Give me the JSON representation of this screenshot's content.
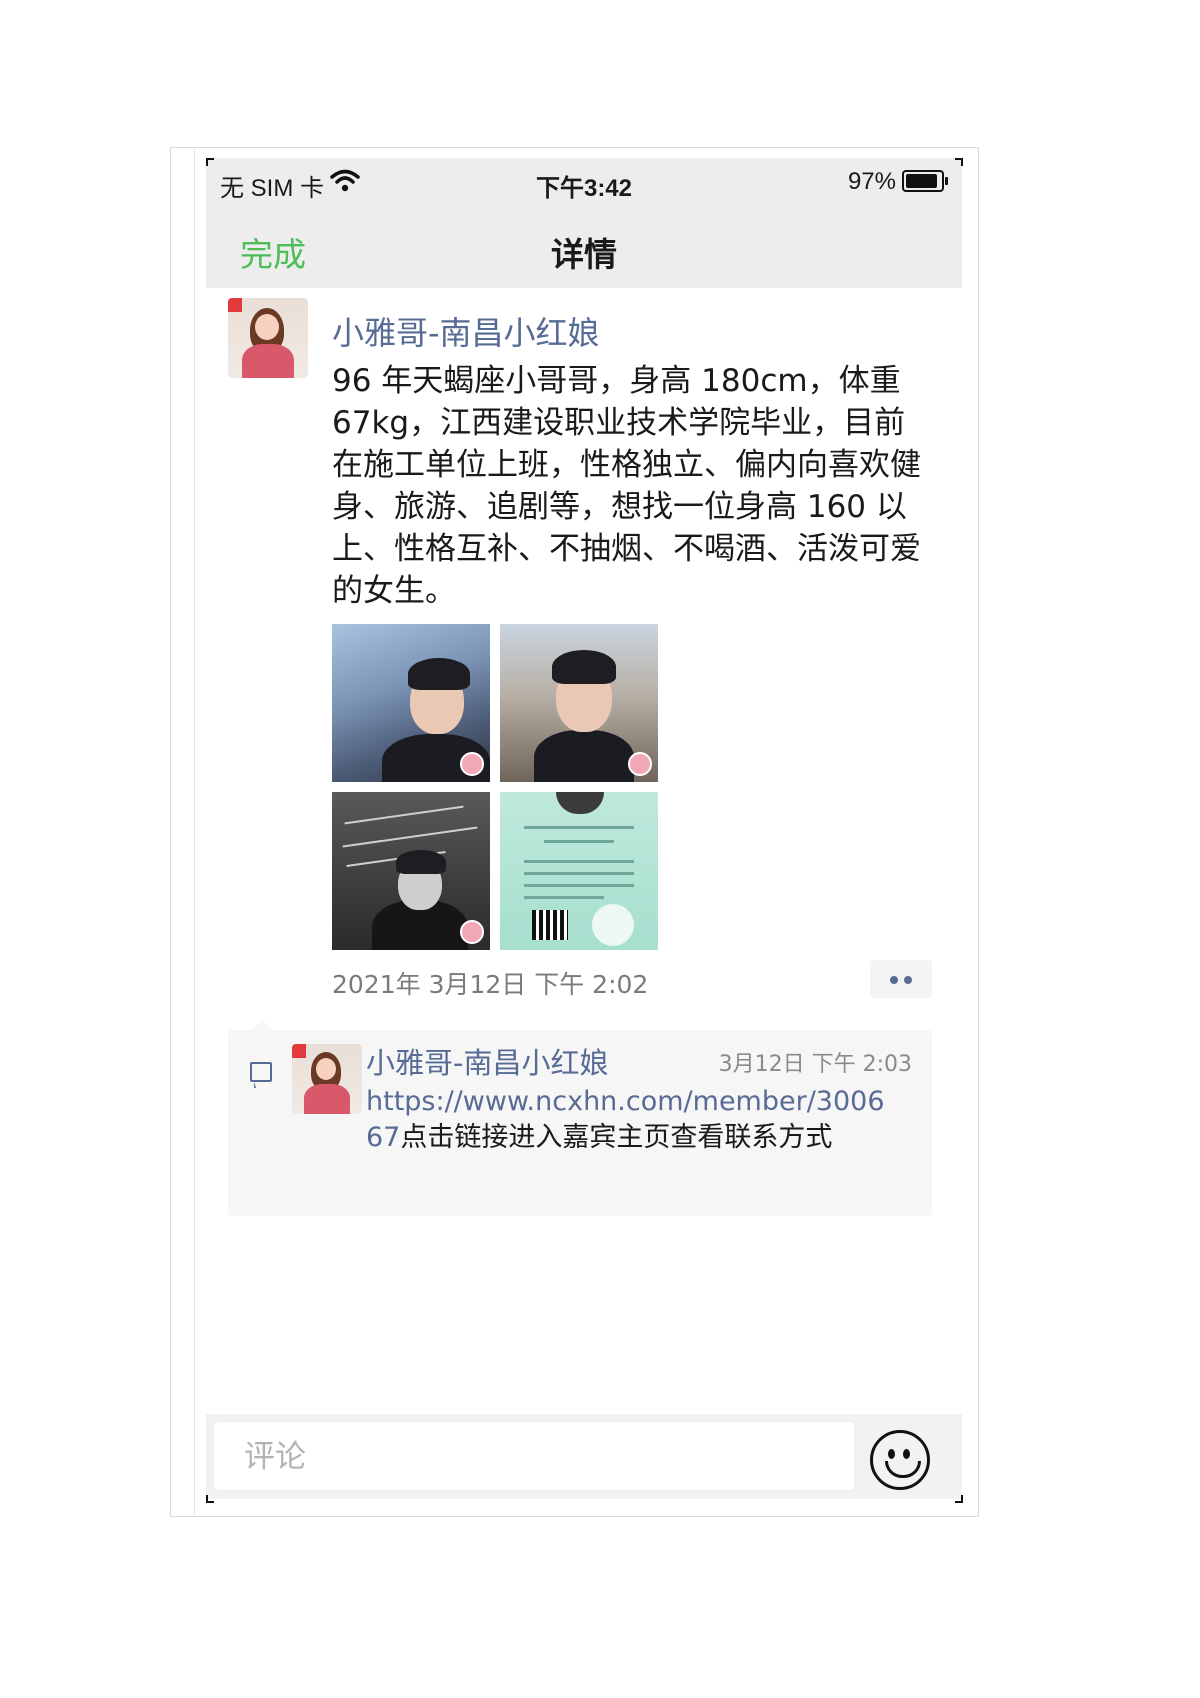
{
  "status_bar": {
    "carrier": "无 SIM 卡",
    "time": "下午3:42",
    "battery_percent": "97%",
    "battery_level": 0.97,
    "icons": [
      "wifi-icon",
      "battery-icon"
    ]
  },
  "navbar": {
    "back_label": "完成",
    "title": "详情"
  },
  "post": {
    "author": "小雅哥-南昌小红娘",
    "text": "96 年天蝎座小哥哥，身高 180cm，体重 67kg，江西建设职业技术学院毕业，目前在施工单位上班，性格独立、偏内向喜欢健身、旅游、追剧等，想找一位身高 160 以上、性格互补、不抽烟、不喝酒、活泼可爱的女生。",
    "timestamp": "2021年 3月12日 下午 2:02",
    "photos": [
      "photo-1",
      "photo-2",
      "photo-3",
      "photo-4"
    ]
  },
  "comment": {
    "author": "小雅哥-南昌小红娘",
    "time": "3月12日 下午 2:03",
    "link": "https://www.ncxhn.com/member/300667",
    "text": "点击链接进入嘉宾主页查看联系方式"
  },
  "input": {
    "placeholder": "评论"
  },
  "colors": {
    "accent_green": "#4cbd57",
    "link_blue": "#576b95"
  }
}
